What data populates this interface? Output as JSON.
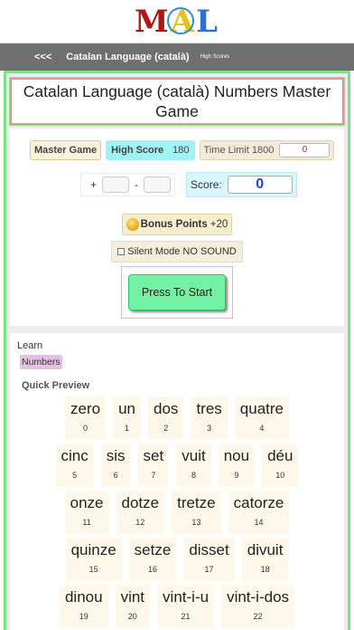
{
  "logo": {
    "text": [
      "M",
      "A",
      "L"
    ]
  },
  "nav": {
    "back": "<<<",
    "title": "Catalan Language (català)",
    "high_scores": "High Scores"
  },
  "title": "Catalan Language (català) Numbers Master Game",
  "game": {
    "master_game": "Master Game",
    "high_score_label": "High Score",
    "high_score_value": "180",
    "time_limit_label": "Time Limit 1800",
    "time_value": "0",
    "plus": "+",
    "minus": "-",
    "score_label": "Score:",
    "score_value": "0",
    "bonus_label": "Bonus Points",
    "bonus_value": "+20",
    "silent_label": "Silent Mode NO SOUND",
    "start_label": "Press To Start"
  },
  "learn": {
    "label": "Learn",
    "tag": "Numbers",
    "quick_preview": "Quick Preview"
  },
  "words": [
    [
      {
        "w": "zero",
        "n": "0"
      },
      {
        "w": "un",
        "n": "1"
      },
      {
        "w": "dos",
        "n": "2"
      },
      {
        "w": "tres",
        "n": "3"
      },
      {
        "w": "quatre",
        "n": "4"
      }
    ],
    [
      {
        "w": "cinc",
        "n": "5"
      },
      {
        "w": "sis",
        "n": "6"
      },
      {
        "w": "set",
        "n": "7"
      },
      {
        "w": "vuit",
        "n": "8"
      },
      {
        "w": "nou",
        "n": "9"
      },
      {
        "w": "déu",
        "n": "10"
      }
    ],
    [
      {
        "w": "onze",
        "n": "11"
      },
      {
        "w": "dotze",
        "n": "12"
      },
      {
        "w": "tretze",
        "n": "13"
      },
      {
        "w": "catorze",
        "n": "14"
      }
    ],
    [
      {
        "w": "quinze",
        "n": "15"
      },
      {
        "w": "setze",
        "n": "16"
      },
      {
        "w": "disset",
        "n": "17"
      },
      {
        "w": "divuit",
        "n": "18"
      }
    ],
    [
      {
        "w": "dinou",
        "n": "19"
      },
      {
        "w": "vint",
        "n": "20"
      },
      {
        "w": "vint-i-u",
        "n": "21"
      },
      {
        "w": "vint-i-dos",
        "n": "22"
      }
    ]
  ]
}
